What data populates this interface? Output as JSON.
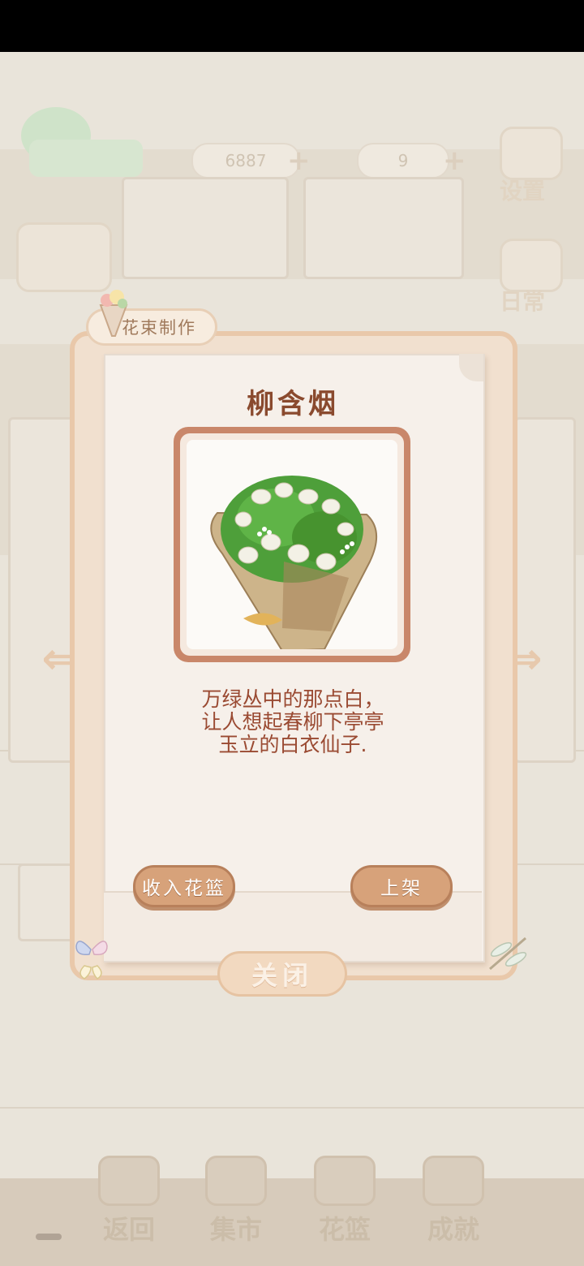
{
  "hud": {
    "coins": "6887",
    "gems": "9",
    "settings_label": "设置",
    "daily_label": "日常"
  },
  "dialog": {
    "tab_label": "花束制作",
    "bouquet_name": "柳含烟",
    "description_lines": [
      "万绿丛中的那点白，",
      "让人想起春柳下亭亭",
      "玉立的白衣仙子."
    ],
    "store_button": "收入花篮",
    "shelve_button": "上架",
    "close_button": "关闭"
  },
  "bottom_nav": [
    {
      "label": "返回",
      "icon": "return-icon"
    },
    {
      "label": "集市",
      "icon": "market-icon"
    },
    {
      "label": "花篮",
      "icon": "basket-icon"
    },
    {
      "label": "成就",
      "icon": "achievement-icon"
    }
  ],
  "colors": {
    "title": "#8a4a2e",
    "description": "#9a4a32",
    "button_fill": "#d7a27a",
    "frame_border": "#e9c8aa",
    "picture_frame": "#c9876a"
  }
}
